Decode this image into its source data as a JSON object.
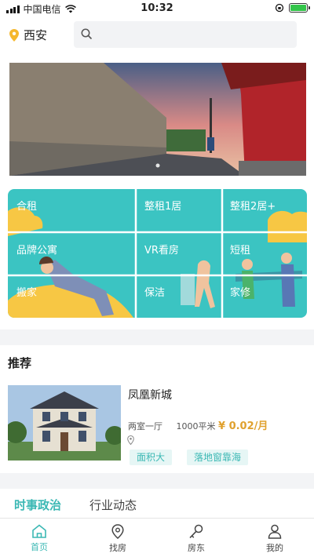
{
  "status_bar": {
    "carrier": "中国电信",
    "time": "10:32"
  },
  "header": {
    "city": "西安",
    "search_placeholder": ""
  },
  "grid": [
    {
      "label": "合租"
    },
    {
      "label": "整租1居"
    },
    {
      "label": "整租2居+"
    },
    {
      "label": "品牌公寓"
    },
    {
      "label": "VR看房"
    },
    {
      "label": "短租"
    },
    {
      "label": "搬家"
    },
    {
      "label": "保洁"
    },
    {
      "label": "家修"
    }
  ],
  "recommend": {
    "title": "推荐",
    "listing": {
      "name": "凤凰新城",
      "layout": "两室一厅",
      "area": "1000平米",
      "price": "¥ 0.02/月",
      "tags": [
        "面积大",
        "落地窗靠海"
      ]
    }
  },
  "news_tabs": [
    "时事政治",
    "行业动态"
  ],
  "tabbar": [
    {
      "label": "首页",
      "icon": "home-icon",
      "active": true
    },
    {
      "label": "找房",
      "icon": "location-icon",
      "active": false
    },
    {
      "label": "房东",
      "icon": "key-icon",
      "active": false
    },
    {
      "label": "我的",
      "icon": "person-icon",
      "active": false
    }
  ],
  "colors": {
    "accent": "#3bb8b4",
    "grid_bg": "#3bc4c2",
    "price": "#e0a12e"
  }
}
